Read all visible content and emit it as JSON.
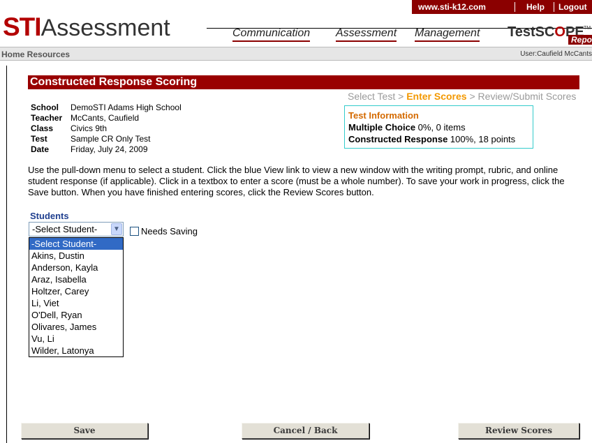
{
  "header": {
    "site_link": "www.sti-k12.com",
    "help_link": "Help",
    "logout_link": "Logout",
    "logo_sti": "STI",
    "logo_assessment": "Assessment",
    "nav": [
      "Communication",
      "Assessment",
      "Management"
    ],
    "testscope_a": "TestSC",
    "testscope_o": "O",
    "testscope_b": "PE",
    "testscope_tm": "TM",
    "reports_label": "Reports"
  },
  "subnav": {
    "home_resources": "Home  Resources",
    "user": "User:Caufield McCants"
  },
  "page": {
    "title": "Constructed Response Scoring",
    "breadcrumb": {
      "step1": "Select Test",
      "sep": " > ",
      "step2": "Enter Scores",
      "step3": "Review/Submit Scores"
    }
  },
  "info": [
    {
      "key": "School",
      "value": "DemoSTI Adams High School"
    },
    {
      "key": "Teacher",
      "value": "McCants, Caufield"
    },
    {
      "key": "Class",
      "value": "Civics 9th"
    },
    {
      "key": "Test",
      "value": "Sample CR Only Test"
    },
    {
      "key": "Date",
      "value": "Friday, July 24, 2009"
    }
  ],
  "test_info": {
    "heading": "Test Information",
    "mc_label": "Multiple Choice",
    "mc_value": " 0%, 0 items",
    "cr_label": "Constructed Response",
    "cr_value": " 100%, 18 points"
  },
  "instructions": "Use the pull-down menu to select a student. Click the blue View link to view a new window with the writing prompt, rubric, and online student response (if applicable). Click in a textbox to enter a score (must be a whole number). To save your work in progress, click the Save button. When you have finished entering scores, click the Review Scores button.",
  "students": {
    "label": "Students",
    "selected": "-Select Student-",
    "needs_saving_label": "Needs Saving",
    "options": [
      "-Select Student-",
      "Akins, Dustin",
      "Anderson, Kayla",
      "Araz, Isabella",
      "Holtzer, Carey",
      "Li, Viet",
      "O'Dell, Ryan",
      "Olivares, James",
      "Vu, Li",
      "Wilder, Latonya"
    ]
  },
  "buttons": {
    "save": "Save",
    "cancel": "Cancel / Back",
    "review": "Review Scores"
  }
}
